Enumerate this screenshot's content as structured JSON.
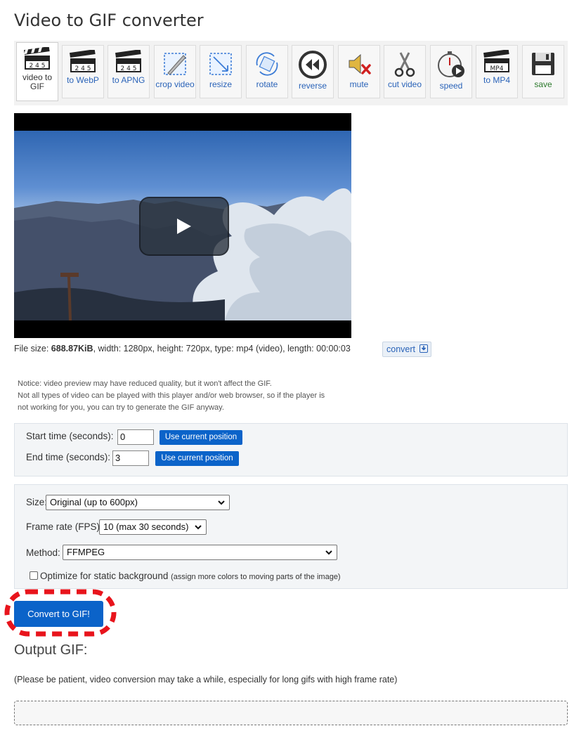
{
  "page": {
    "title": "Video to GIF converter"
  },
  "toolbar": {
    "items": [
      {
        "label": "video to GIF",
        "icon": "clapperboard-icon"
      },
      {
        "label": "to WebP",
        "icon": "clapperboard-icon"
      },
      {
        "label": "to APNG",
        "icon": "clapperboard-icon"
      },
      {
        "label": "crop video",
        "icon": "crop-icon"
      },
      {
        "label": "resize",
        "icon": "resize-icon"
      },
      {
        "label": "rotate",
        "icon": "rotate-icon"
      },
      {
        "label": "reverse",
        "icon": "rewind-icon"
      },
      {
        "label": "mute",
        "icon": "speaker-muted-icon"
      },
      {
        "label": "cut video",
        "icon": "scissors-icon"
      },
      {
        "label": "speed",
        "icon": "stopwatch-icon"
      },
      {
        "label": "to MP4",
        "icon": "clapperboard-icon"
      },
      {
        "label": "save",
        "icon": "floppy-disk-icon"
      }
    ],
    "clap_digits": "2 4 5",
    "mp4_label": "MP4"
  },
  "file_info": {
    "prefix": "File size: ",
    "size": "688.87KiB",
    "rest": ", width: 1280px, height: 720px, type: mp4 (video), length: 00:00:03",
    "convert_label": "convert"
  },
  "notice": {
    "line1": "Notice: video preview may have reduced quality, but it won't affect the GIF.",
    "line2": "Not all types of video can be played with this player and/or web browser, so if the player is",
    "line3": "not working for you, you can try to generate the GIF anyway."
  },
  "time": {
    "start_label": "Start time (seconds):",
    "start_value": "0",
    "end_label": "End time (seconds):",
    "end_value": "3",
    "use_current": "Use current position"
  },
  "options": {
    "size_label": "Size:",
    "size_value": "Original (up to 600px)",
    "fps_label": "Frame rate (FPS):",
    "fps_value": "10 (max 30 seconds)",
    "method_label": "Method:",
    "method_value": "FFMPEG",
    "optimize_label": "Optimize for static background",
    "optimize_note": "(assign more colors to moving parts of the image)",
    "optimize_checked": false
  },
  "actions": {
    "convert_gif": "Convert to GIF!"
  },
  "output": {
    "title": "Output GIF:",
    "note": "(Please be patient, video conversion may take a while, especially for long gifs with high frame rate)"
  },
  "colors": {
    "accent": "#0b63c9",
    "link": "#2a63b8",
    "highlight": "#e8141c"
  }
}
